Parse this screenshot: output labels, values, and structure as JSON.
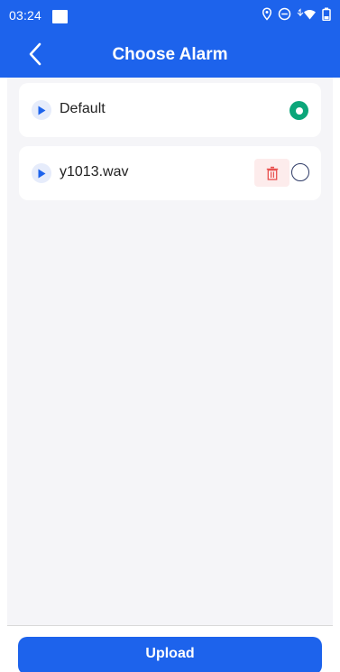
{
  "status_bar": {
    "time": "03:24",
    "icons": [
      "notification-square-icon",
      "location-pin-icon",
      "do-not-disturb-icon",
      "wifi-icon",
      "battery-icon"
    ]
  },
  "header": {
    "title": "Choose Alarm",
    "back_icon": "chevron-left-icon"
  },
  "alarm_list": [
    {
      "label": "Default",
      "selected": true,
      "deletable": false
    },
    {
      "label": "y1013.wav",
      "selected": false,
      "deletable": true
    }
  ],
  "footer": {
    "upload_label": "Upload"
  },
  "colors": {
    "primary": "#1d63ec",
    "selected": "#0ca67a",
    "delete_bg": "#fdecec",
    "delete_icon": "#e8504f",
    "content_bg": "#f5f5f8"
  }
}
